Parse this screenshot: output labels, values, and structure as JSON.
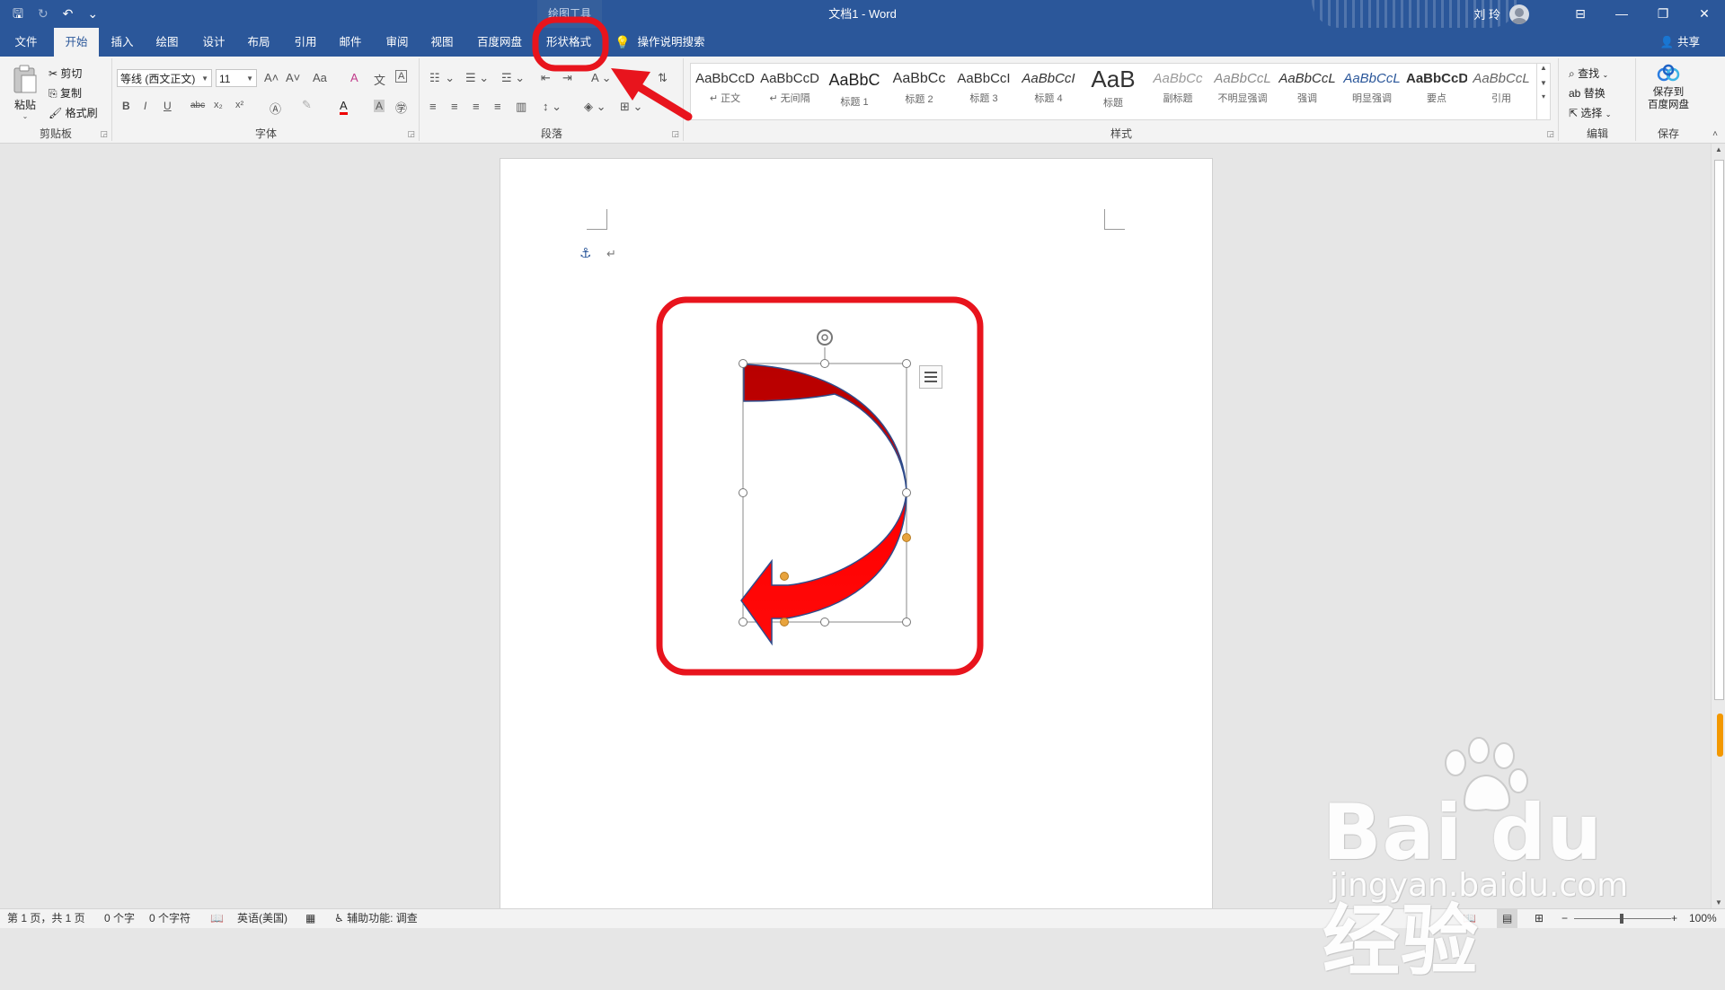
{
  "titlebar": {
    "tool_context": "绘图工具",
    "doc_title": "文档1 - Word",
    "user": "刘 玲",
    "qat": {
      "save": "🖫",
      "redo": "↻",
      "undo": "↶",
      "customize": "⌄"
    },
    "win": {
      "ribbon_display": "⊟",
      "minimize": "—",
      "restore": "❐",
      "close": "✕"
    }
  },
  "tabs": {
    "items": [
      "文件",
      "开始",
      "插入",
      "绘图",
      "设计",
      "布局",
      "引用",
      "邮件",
      "审阅",
      "视图",
      "百度网盘",
      "形状格式"
    ],
    "active": "开始",
    "search": "操作说明搜索",
    "share": "共享"
  },
  "clipboard": {
    "paste": "粘贴",
    "cut": "剪切",
    "copy": "复制",
    "format_painter": "格式刷",
    "label": "剪贴板"
  },
  "font": {
    "font_name": "等线 (西文正文)",
    "font_size": "11",
    "grow": "A˄",
    "shrink": "A˅",
    "case": "Aa",
    "clear": "A",
    "bold": "B",
    "italic": "I",
    "underline": "U",
    "strike": "abc",
    "subscript": "x₂",
    "superscript": "x²",
    "color_a": "A",
    "label": "字体"
  },
  "paragraph": {
    "label": "段落"
  },
  "styles": {
    "label": "样式",
    "items": [
      {
        "sample": "AaBbCcD",
        "name": "↵ 正文"
      },
      {
        "sample": "AaBbCcD",
        "name": "↵ 无间隔"
      },
      {
        "sample": "AaBbC",
        "name": "标题 1"
      },
      {
        "sample": "AaBbCc",
        "name": "标题 2"
      },
      {
        "sample": "AaBbCcI",
        "name": "标题 3"
      },
      {
        "sample": "AaBbCcI",
        "name": "标题 4"
      },
      {
        "sample": "AaB",
        "name": "标题"
      },
      {
        "sample": "AaBbCc",
        "name": "副标题"
      },
      {
        "sample": "AaBbCcL",
        "name": "不明显强调"
      },
      {
        "sample": "AaBbCcL",
        "name": "强调"
      },
      {
        "sample": "AaBbCcL",
        "name": "明显强调"
      },
      {
        "sample": "AaBbCcD",
        "name": "要点"
      },
      {
        "sample": "AaBbCcL",
        "name": "引用"
      }
    ]
  },
  "editing": {
    "find": "查找",
    "replace": "替换",
    "select": "选择",
    "label": "编辑"
  },
  "save_group": {
    "button": "保存到\n百度网盘",
    "label": "保存"
  },
  "document": {
    "anchor": "⚓",
    "paragraph_mark": "↵"
  },
  "status": {
    "page": "第 1 页，共 1 页",
    "words": "0 个字",
    "chars": "0 个字符",
    "language": "英语(美国)",
    "accessibility": "辅助功能: 调查",
    "zoom": "100%"
  },
  "colors": {
    "brand": "#2b579a",
    "arrow_fill_top": "#c00000",
    "arrow_fill_bottom": "#ff0000",
    "arrow_stroke": "#2f4b8a",
    "annotation": "#e8141d",
    "handle_yellow": "#e8a33d"
  },
  "watermark": {
    "logo": "Bai du 经验",
    "url": "jingyan.baidu.com"
  }
}
